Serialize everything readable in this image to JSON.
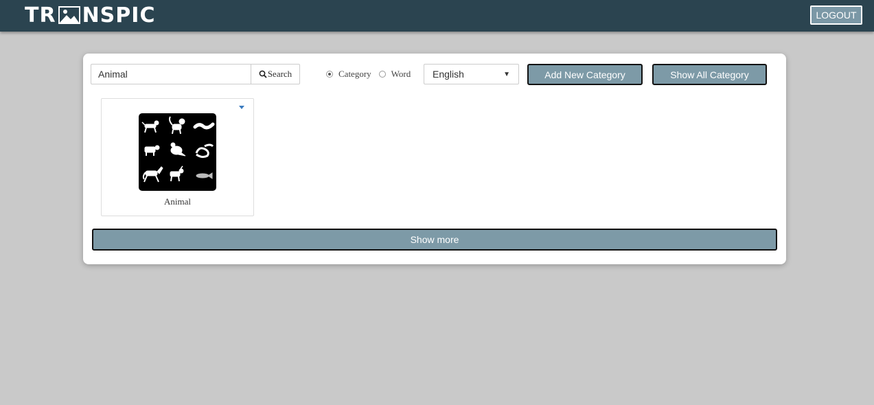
{
  "header": {
    "logo_left": "TR",
    "logo_right": "NSPIC",
    "logout_label": "LOGOUT"
  },
  "toolbar": {
    "search_value": "Animal",
    "search_button_label": "Search",
    "radio_options": [
      {
        "label": "Category",
        "checked": true
      },
      {
        "label": "Word",
        "checked": false
      }
    ],
    "language_selected": "English",
    "add_category_label": "Add New Category",
    "show_all_label": "Show All Category"
  },
  "cards": [
    {
      "label": "Animal",
      "image_icon": "animal-collage-image"
    }
  ],
  "show_more_label": "Show more",
  "colors": {
    "header_bg": "#2b4450",
    "button_bg": "#7d9aa7",
    "page_bg": "#c9c9c9"
  }
}
